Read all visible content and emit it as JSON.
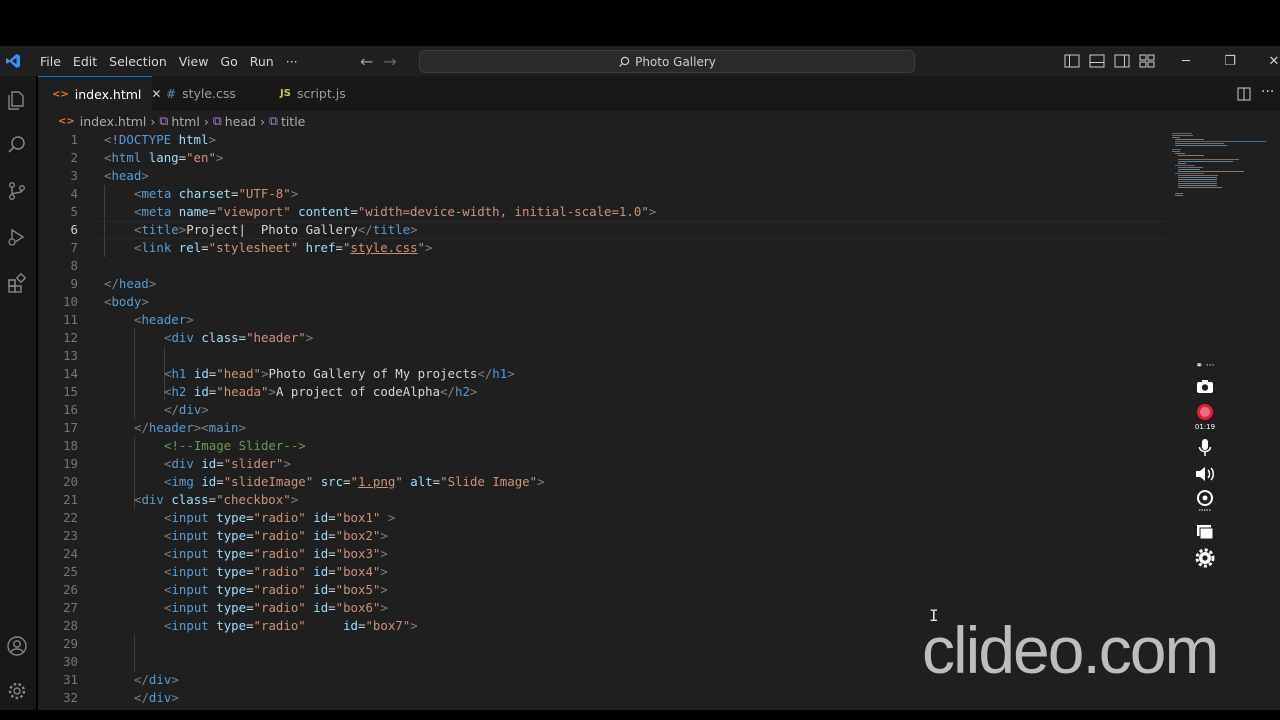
{
  "menu": [
    "File",
    "Edit",
    "Selection",
    "View",
    "Go",
    "Run",
    "···"
  ],
  "command_center": {
    "label": "Photo Gallery"
  },
  "tabs": [
    {
      "icon": "<>",
      "label": "index.html",
      "active": true,
      "close": "✕"
    },
    {
      "icon": "#",
      "label": "style.css",
      "active": false
    },
    {
      "icon": "JS",
      "label": "script.js",
      "active": false
    }
  ],
  "breadcrumb": [
    "index.html",
    "html",
    "head",
    "title"
  ],
  "editor": {
    "current_line": 6,
    "lines": [
      {
        "n": "1",
        "indent": 0,
        "tokens": [
          [
            "b",
            "<"
          ],
          [
            "t",
            "!DOCTYPE "
          ],
          [
            "a",
            "html"
          ],
          [
            "b",
            ">"
          ]
        ]
      },
      {
        "n": "2",
        "indent": 0,
        "tokens": [
          [
            "b",
            "<"
          ],
          [
            "t",
            "html "
          ],
          [
            "a",
            "lang"
          ],
          [
            "x",
            "="
          ],
          [
            "s",
            "\"en\""
          ],
          [
            "b",
            ">"
          ]
        ]
      },
      {
        "n": "3",
        "indent": 0,
        "tokens": [
          [
            "b",
            "<"
          ],
          [
            "t",
            "head"
          ],
          [
            "b",
            ">"
          ]
        ]
      },
      {
        "n": "4",
        "indent": 1,
        "tokens": [
          [
            "b",
            "<"
          ],
          [
            "t",
            "meta "
          ],
          [
            "a",
            "charset"
          ],
          [
            "x",
            "="
          ],
          [
            "s",
            "\"UTF-8\""
          ],
          [
            "b",
            ">"
          ]
        ]
      },
      {
        "n": "5",
        "indent": 1,
        "tokens": [
          [
            "b",
            "<"
          ],
          [
            "t",
            "meta "
          ],
          [
            "a",
            "name"
          ],
          [
            "x",
            "="
          ],
          [
            "s",
            "\"viewport\" "
          ],
          [
            "a",
            "content"
          ],
          [
            "x",
            "="
          ],
          [
            "s",
            "\"width=device-width, initial-scale=1.0\""
          ],
          [
            "b",
            ">"
          ]
        ]
      },
      {
        "n": "6",
        "indent": 1,
        "tokens": [
          [
            "b",
            "<"
          ],
          [
            "t",
            "title"
          ],
          [
            "b",
            ">"
          ],
          [
            "x",
            "Project|  Photo Gallery"
          ],
          [
            "b",
            "</"
          ],
          [
            "t",
            "title"
          ],
          [
            "b",
            ">"
          ]
        ]
      },
      {
        "n": "7",
        "indent": 1,
        "tokens": [
          [
            "b",
            "<"
          ],
          [
            "t",
            "link "
          ],
          [
            "a",
            "rel"
          ],
          [
            "x",
            "="
          ],
          [
            "s",
            "\"stylesheet\" "
          ],
          [
            "a",
            "href"
          ],
          [
            "x",
            "="
          ],
          [
            "s",
            "\""
          ],
          [
            "su",
            "style.css"
          ],
          [
            "s",
            "\""
          ],
          [
            "b",
            ">"
          ]
        ]
      },
      {
        "n": "8",
        "indent": 0,
        "tokens": []
      },
      {
        "n": "9",
        "indent": 0,
        "tokens": [
          [
            "b",
            "</"
          ],
          [
            "t",
            "head"
          ],
          [
            "b",
            ">"
          ]
        ]
      },
      {
        "n": "10",
        "indent": 0,
        "tokens": [
          [
            "b",
            "<"
          ],
          [
            "t",
            "body"
          ],
          [
            "b",
            ">"
          ]
        ]
      },
      {
        "n": "11",
        "indent": 1,
        "tokens": [
          [
            "b",
            "<"
          ],
          [
            "t",
            "header"
          ],
          [
            "b",
            ">"
          ]
        ]
      },
      {
        "n": "12",
        "indent": 2,
        "tokens": [
          [
            "b",
            "<"
          ],
          [
            "t",
            "div "
          ],
          [
            "a",
            "class"
          ],
          [
            "x",
            "="
          ],
          [
            "s",
            "\"header\""
          ],
          [
            "b",
            ">"
          ]
        ]
      },
      {
        "n": "13",
        "indent": 0,
        "tokens": []
      },
      {
        "n": "14",
        "indent": 2,
        "tokens": [
          [
            "b",
            "<"
          ],
          [
            "t",
            "h1 "
          ],
          [
            "a",
            "id"
          ],
          [
            "x",
            "="
          ],
          [
            "s",
            "\"head\""
          ],
          [
            "b",
            ">"
          ],
          [
            "x",
            "Photo Gallery of My projects"
          ],
          [
            "b",
            "</"
          ],
          [
            "t",
            "h1"
          ],
          [
            "b",
            ">"
          ]
        ]
      },
      {
        "n": "15",
        "indent": 2,
        "tokens": [
          [
            "b",
            "<"
          ],
          [
            "t",
            "h2 "
          ],
          [
            "a",
            "id"
          ],
          [
            "x",
            "="
          ],
          [
            "s",
            "\"heada\""
          ],
          [
            "b",
            ">"
          ],
          [
            "x",
            "A project of codeAlpha"
          ],
          [
            "b",
            "</"
          ],
          [
            "t",
            "h2"
          ],
          [
            "b",
            ">"
          ]
        ]
      },
      {
        "n": "16",
        "indent": 2,
        "tokens": [
          [
            "b",
            "</"
          ],
          [
            "t",
            "div"
          ],
          [
            "b",
            ">"
          ]
        ]
      },
      {
        "n": "17",
        "indent": 1,
        "tokens": [
          [
            "b",
            "</"
          ],
          [
            "t",
            "header"
          ],
          [
            "b",
            "><"
          ],
          [
            "t",
            "main"
          ],
          [
            "b",
            ">"
          ]
        ]
      },
      {
        "n": "18",
        "indent": 2,
        "tokens": [
          [
            "c",
            "<!--Image Slider-->"
          ]
        ]
      },
      {
        "n": "19",
        "indent": 2,
        "tokens": [
          [
            "b",
            "<"
          ],
          [
            "t",
            "div "
          ],
          [
            "a",
            "id"
          ],
          [
            "x",
            "="
          ],
          [
            "s",
            "\"slider\""
          ],
          [
            "b",
            ">"
          ]
        ]
      },
      {
        "n": "20",
        "indent": 2,
        "tokens": [
          [
            "b",
            "<"
          ],
          [
            "t",
            "img "
          ],
          [
            "a",
            "id"
          ],
          [
            "x",
            "="
          ],
          [
            "s",
            "\"slideImage\" "
          ],
          [
            "a",
            "src"
          ],
          [
            "x",
            "="
          ],
          [
            "s",
            "\""
          ],
          [
            "su",
            "1.png"
          ],
          [
            "s",
            "\" "
          ],
          [
            "a",
            "alt"
          ],
          [
            "x",
            "="
          ],
          [
            "s",
            "\"Slide Image\""
          ],
          [
            "b",
            ">"
          ]
        ]
      },
      {
        "n": "21",
        "indent": 1,
        "tokens": [
          [
            "b",
            "<"
          ],
          [
            "t",
            "div "
          ],
          [
            "a",
            "class"
          ],
          [
            "x",
            "="
          ],
          [
            "s",
            "\"checkbox\""
          ],
          [
            "b",
            ">"
          ]
        ]
      },
      {
        "n": "22",
        "indent": 2,
        "tokens": [
          [
            "b",
            "<"
          ],
          [
            "t",
            "input "
          ],
          [
            "a",
            "type"
          ],
          [
            "x",
            "="
          ],
          [
            "s",
            "\"radio\" "
          ],
          [
            "a",
            "id"
          ],
          [
            "x",
            "="
          ],
          [
            "s",
            "\"box1\" "
          ],
          [
            "b",
            ">"
          ]
        ]
      },
      {
        "n": "23",
        "indent": 2,
        "tokens": [
          [
            "b",
            "<"
          ],
          [
            "t",
            "input "
          ],
          [
            "a",
            "type"
          ],
          [
            "x",
            "="
          ],
          [
            "s",
            "\"radio\" "
          ],
          [
            "a",
            "id"
          ],
          [
            "x",
            "="
          ],
          [
            "s",
            "\"box2\""
          ],
          [
            "b",
            ">"
          ]
        ]
      },
      {
        "n": "24",
        "indent": 2,
        "tokens": [
          [
            "b",
            "<"
          ],
          [
            "t",
            "input "
          ],
          [
            "a",
            "type"
          ],
          [
            "x",
            "="
          ],
          [
            "s",
            "\"radio\" "
          ],
          [
            "a",
            "id"
          ],
          [
            "x",
            "="
          ],
          [
            "s",
            "\"box3\""
          ],
          [
            "b",
            ">"
          ]
        ]
      },
      {
        "n": "25",
        "indent": 2,
        "tokens": [
          [
            "b",
            "<"
          ],
          [
            "t",
            "input "
          ],
          [
            "a",
            "type"
          ],
          [
            "x",
            "="
          ],
          [
            "s",
            "\"radio\" "
          ],
          [
            "a",
            "id"
          ],
          [
            "x",
            "="
          ],
          [
            "s",
            "\"box4\""
          ],
          [
            "b",
            ">"
          ]
        ]
      },
      {
        "n": "26",
        "indent": 2,
        "tokens": [
          [
            "b",
            "<"
          ],
          [
            "t",
            "input "
          ],
          [
            "a",
            "type"
          ],
          [
            "x",
            "="
          ],
          [
            "s",
            "\"radio\" "
          ],
          [
            "a",
            "id"
          ],
          [
            "x",
            "="
          ],
          [
            "s",
            "\"box5\""
          ],
          [
            "b",
            ">"
          ]
        ]
      },
      {
        "n": "27",
        "indent": 2,
        "tokens": [
          [
            "b",
            "<"
          ],
          [
            "t",
            "input "
          ],
          [
            "a",
            "type"
          ],
          [
            "x",
            "="
          ],
          [
            "s",
            "\"radio\" "
          ],
          [
            "a",
            "id"
          ],
          [
            "x",
            "="
          ],
          [
            "s",
            "\"box6\""
          ],
          [
            "b",
            ">"
          ]
        ]
      },
      {
        "n": "28",
        "indent": 2,
        "tokens": [
          [
            "b",
            "<"
          ],
          [
            "t",
            "input "
          ],
          [
            "a",
            "type"
          ],
          [
            "x",
            "="
          ],
          [
            "s",
            "\"radio\"     "
          ],
          [
            "a",
            "id"
          ],
          [
            "x",
            "="
          ],
          [
            "s",
            "\"box7\""
          ],
          [
            "b",
            ">"
          ]
        ]
      },
      {
        "n": "29",
        "indent": 0,
        "tokens": []
      },
      {
        "n": "30",
        "indent": 0,
        "tokens": []
      },
      {
        "n": "31",
        "indent": 1,
        "tokens": [
          [
            "b",
            "</"
          ],
          [
            "t",
            "div"
          ],
          [
            "b",
            ">"
          ]
        ]
      },
      {
        "n": "32",
        "indent": 1,
        "tokens": [
          [
            "b",
            "</"
          ],
          [
            "t",
            "div"
          ],
          [
            "b",
            ">"
          ]
        ]
      }
    ]
  },
  "recorder": {
    "time": "01:19"
  },
  "watermark": "clideo.com",
  "colors": {
    "accent": "#0078d4",
    "vscode_blue": "#3794ff",
    "record_red": "#e51c3c"
  }
}
